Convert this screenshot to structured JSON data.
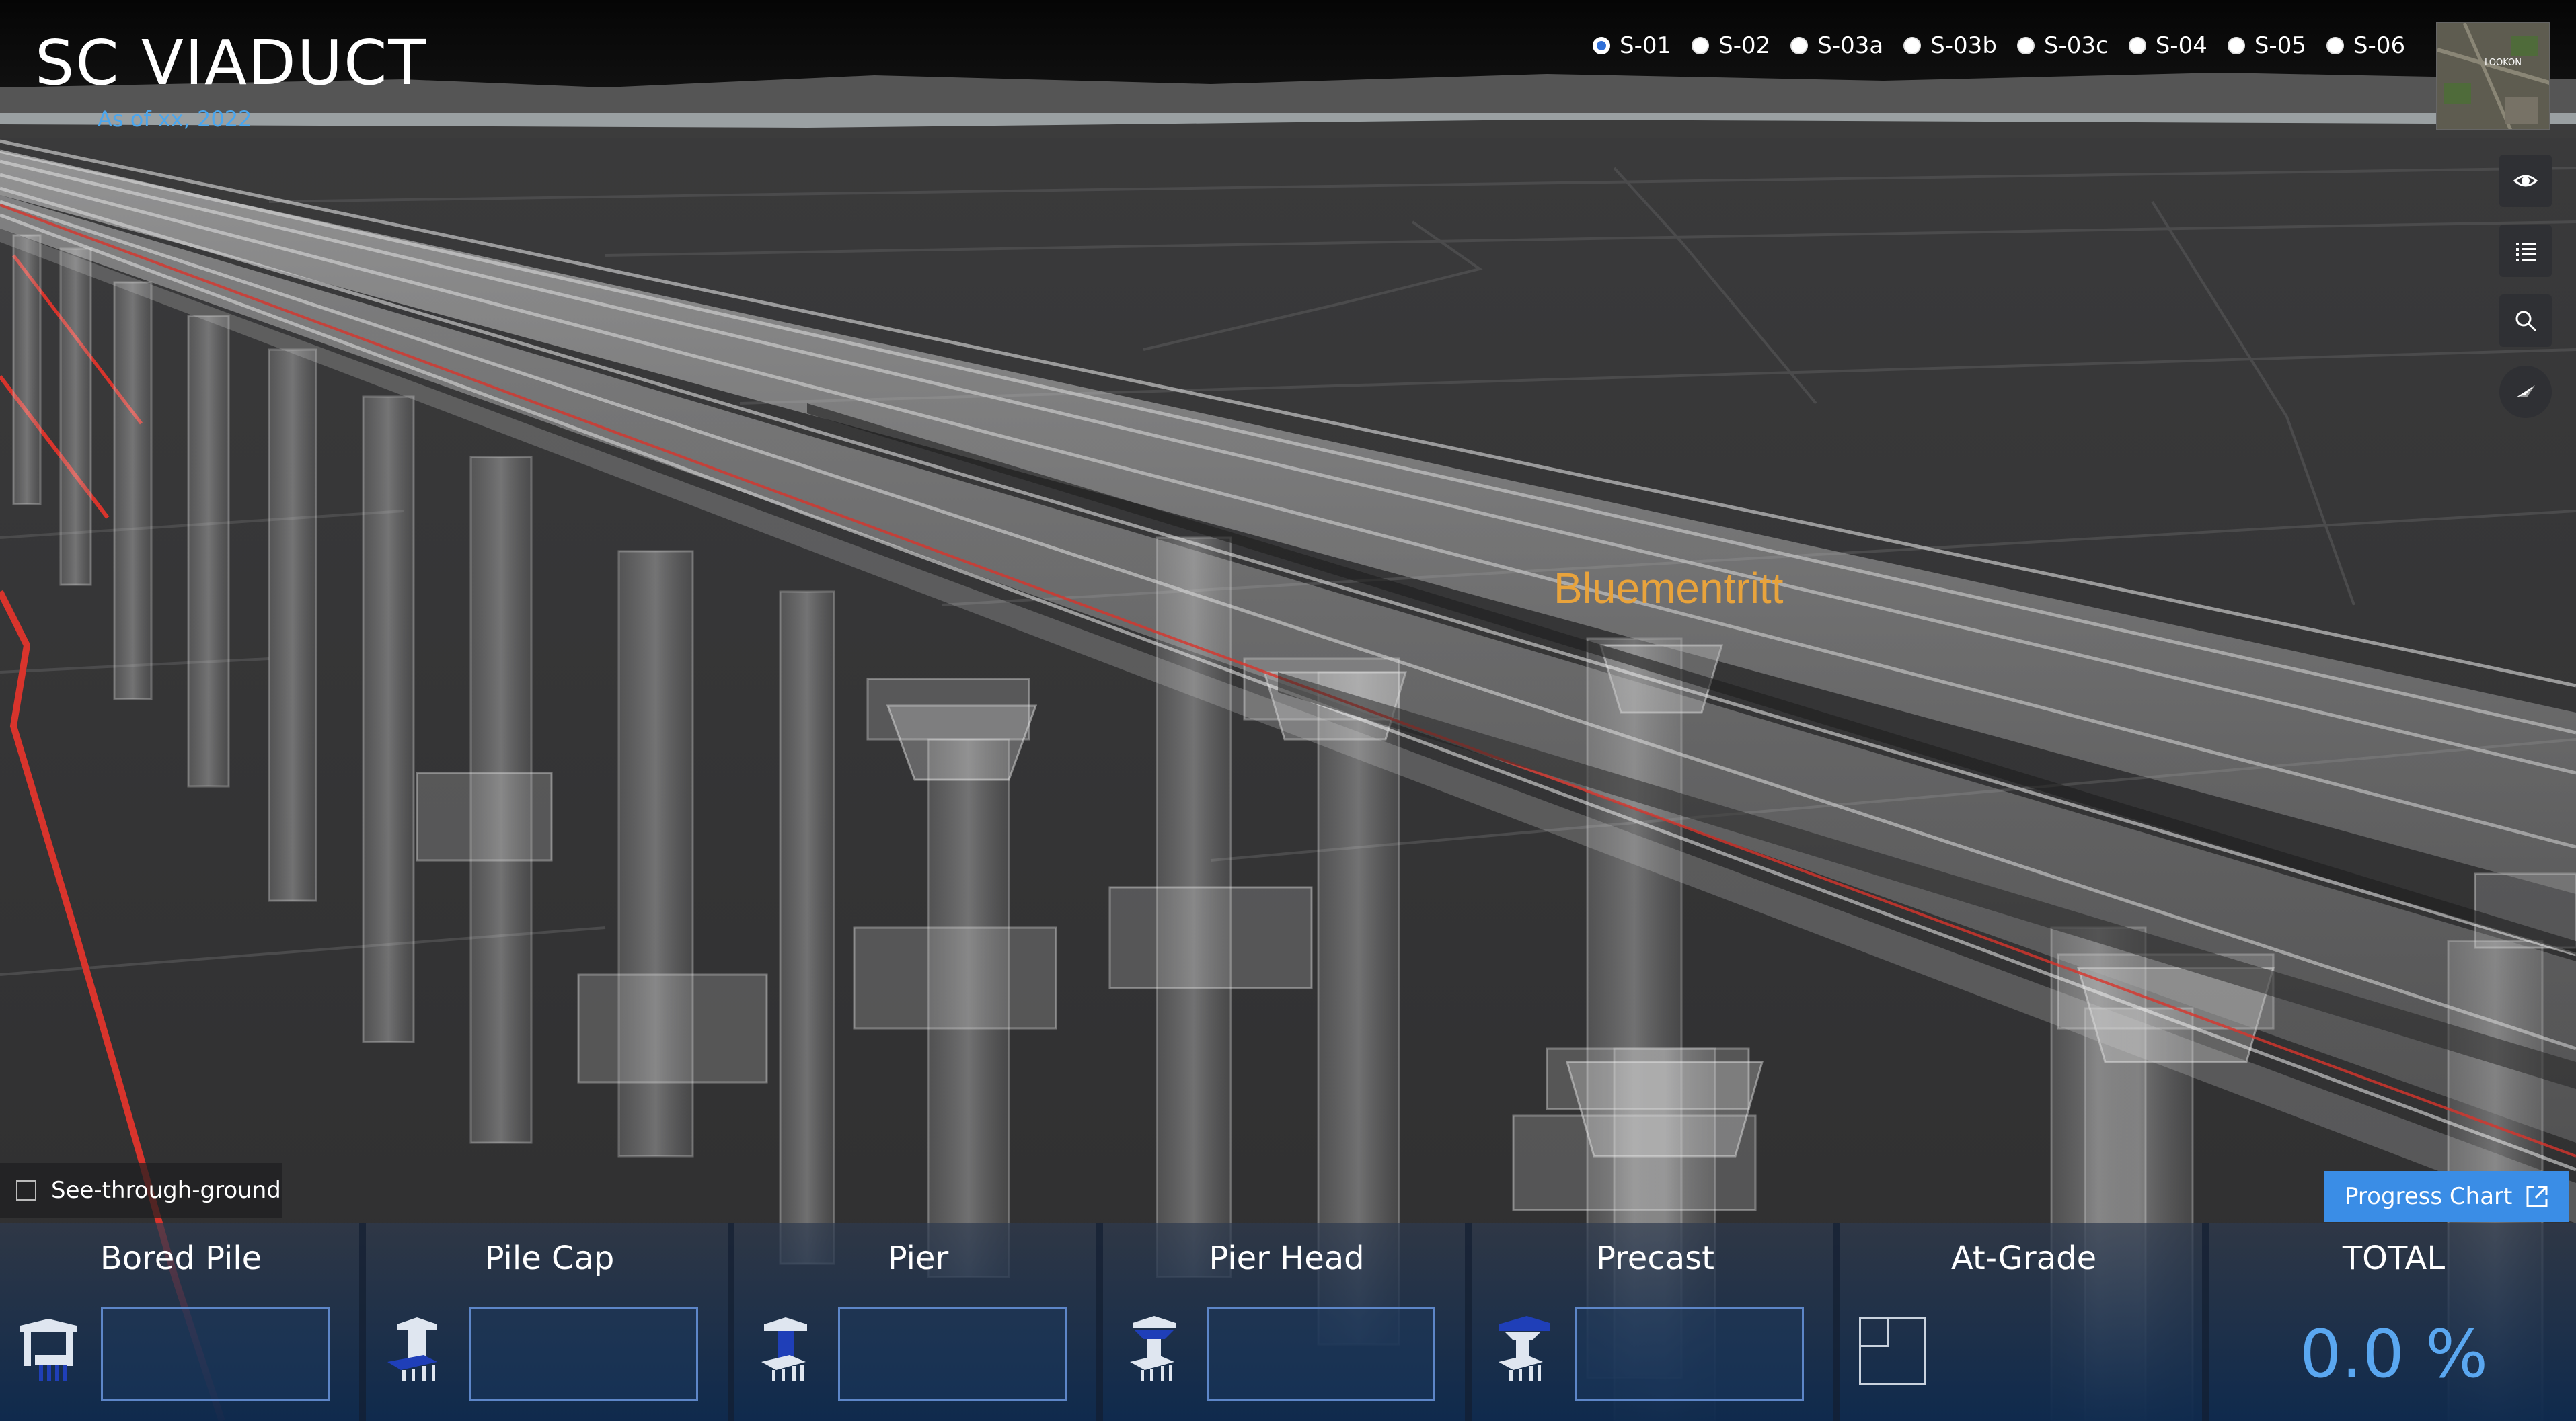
{
  "app": {
    "title": "SC VIADUCT",
    "subtitle": "As of xx, 2022"
  },
  "segments": [
    {
      "label": "S-01",
      "selected": true
    },
    {
      "label": "S-02",
      "selected": false
    },
    {
      "label": "S-03a",
      "selected": false
    },
    {
      "label": "S-03b",
      "selected": false
    },
    {
      "label": "S-03c",
      "selected": false
    },
    {
      "label": "S-04",
      "selected": false
    },
    {
      "label": "S-05",
      "selected": false
    },
    {
      "label": "S-06",
      "selected": false
    }
  ],
  "minimap": {
    "label": "LOOKON"
  },
  "tools": [
    {
      "icon": "eye-icon"
    },
    {
      "icon": "layer-list-icon"
    },
    {
      "icon": "search-icon"
    },
    {
      "icon": "compass-icon"
    }
  ],
  "scene": {
    "place_label": "Bluementritt"
  },
  "see_through": {
    "label": "See-through-ground",
    "checked": false
  },
  "progress_button": {
    "label": "Progress Chart"
  },
  "components": [
    {
      "name": "Bored Pile",
      "progress": 0
    },
    {
      "name": "Pile Cap",
      "progress": 0
    },
    {
      "name": "Pier",
      "progress": 0
    },
    {
      "name": "Pier Head",
      "progress": 0
    },
    {
      "name": "Precast",
      "progress": 0
    },
    {
      "name": "At-Grade"
    }
  ],
  "total": {
    "label": "TOTAL",
    "value": "0.0 %"
  },
  "colors": {
    "accent": "#3a8de6",
    "subtitle": "#4aa6ee",
    "place_label": "#e8a33c",
    "alignment_line": "#d8342c"
  }
}
